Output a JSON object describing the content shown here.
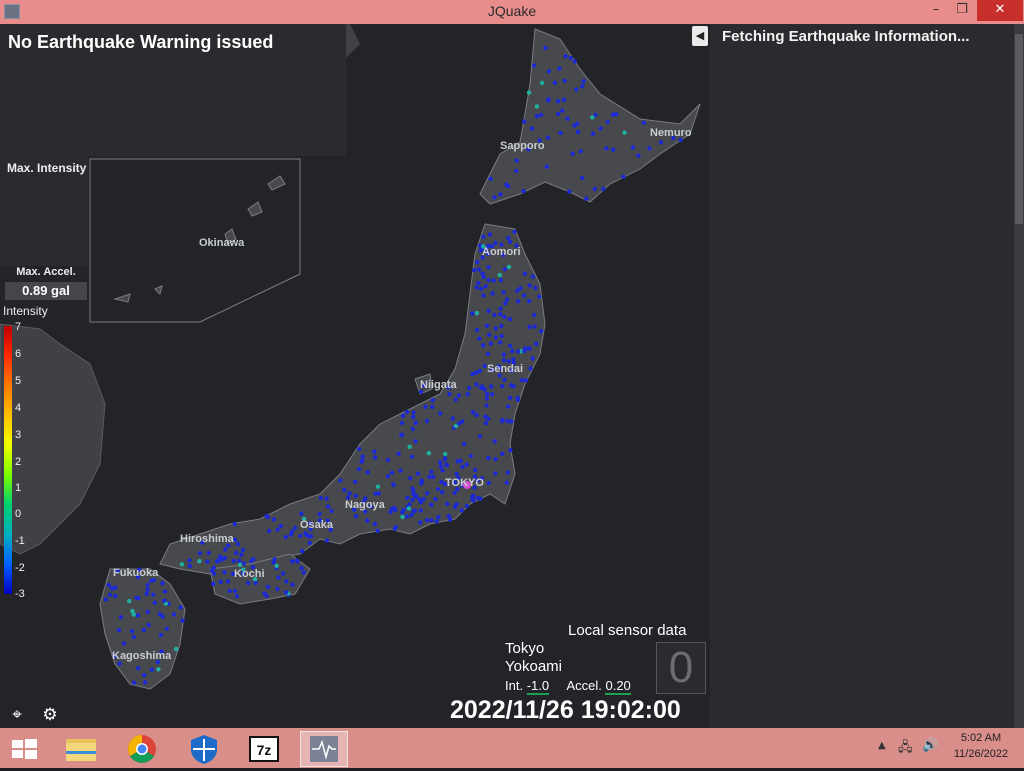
{
  "window": {
    "title": "JQuake"
  },
  "map": {
    "warning": "No Earthquake Warning issued",
    "max_intensity_label": "Max. Intensity",
    "max_accel_label": "Max. Accel.",
    "max_accel_value": "0.89 gal",
    "intensity_scale_title": "Intensity",
    "intensity_ticks": [
      "7",
      "6",
      "5",
      "4",
      "3",
      "2",
      "1",
      "0",
      "-1",
      "-2",
      "-3"
    ],
    "place_labels": [
      "Sapporo",
      "Nemuro",
      "Okinawa",
      "Aomori",
      "Sendai",
      "Niigata",
      "TOKYO",
      "Nagoya",
      "Osaka",
      "Hiroshima",
      "Kochi",
      "Fukuoka",
      "Kagoshima"
    ],
    "local_sensor": {
      "title": "Local sensor data",
      "location_1": "Tokyo",
      "location_2": "Yokoami",
      "int_label": "Int.",
      "int_value": "-1.0",
      "accel_label": "Accel.",
      "accel_value": "0.20",
      "shindo": "0"
    },
    "clock": "2022/11/26 19:02:00",
    "colors": {
      "sensor_low": "#1c2ad6",
      "sensor_mid": "#1fb0a0",
      "epicenter": "#d94fd4",
      "land": "#48494d",
      "sea": "#232428"
    }
  },
  "sidebar": {
    "status": "Fetching Earthquake Information..."
  },
  "taskbar": {
    "apps": [
      "windows-start",
      "file-explorer",
      "chrome",
      "windows-security",
      "7zip",
      "jquake"
    ],
    "time": "5:02 AM",
    "date": "11/26/2022"
  }
}
